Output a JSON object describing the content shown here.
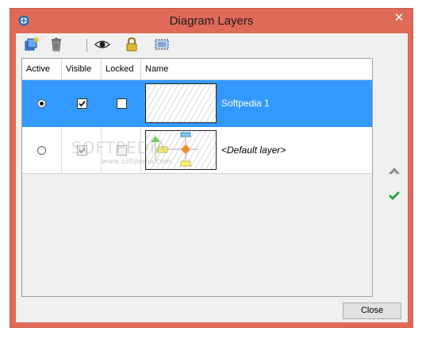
{
  "window": {
    "title": "Diagram Layers",
    "close_glyph": "✕"
  },
  "toolbar": [
    {
      "name": "new-layer-icon"
    },
    {
      "name": "trash-icon"
    },
    {
      "name": "eye-icon"
    },
    {
      "name": "lock-icon"
    },
    {
      "name": "select-area-icon"
    }
  ],
  "columns": {
    "active": "Active",
    "visible": "Visible",
    "locked": "Locked",
    "name": "Name"
  },
  "layers": [
    {
      "name": "Softpedia 1",
      "active": true,
      "visible": true,
      "locked": false,
      "selected": true
    },
    {
      "name": "<Default layer>",
      "active": false,
      "visible": true,
      "locked": false,
      "selected": false
    }
  ],
  "side_buttons": [
    {
      "name": "move-up-icon",
      "color": "#8a8a8a"
    },
    {
      "name": "confirm-check-icon",
      "color": "#2fa23a"
    }
  ],
  "buttons": {
    "close": "Close"
  },
  "watermark": {
    "big": "SOFTPEDIA",
    "small": "www.softpedia.com"
  },
  "colors": {
    "selection": "#3399ff",
    "frame": "#e06a58"
  }
}
